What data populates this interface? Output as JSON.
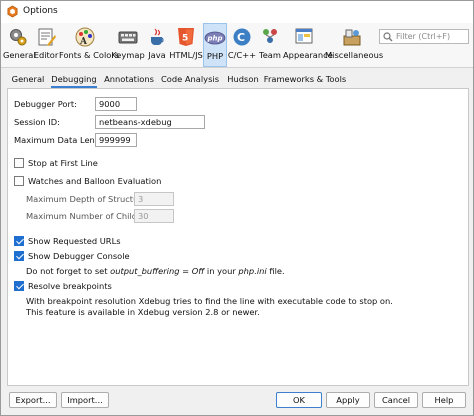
{
  "window": {
    "title": "Options"
  },
  "toolbar": {
    "categories": [
      {
        "label": "General",
        "icon": "gear-icon"
      },
      {
        "label": "Editor",
        "icon": "editor-icon"
      },
      {
        "label": "Fonts & Colors",
        "icon": "fonts-colors-icon"
      },
      {
        "label": "Keymap",
        "icon": "keyboard-icon"
      },
      {
        "label": "Java",
        "icon": "java-cup-icon"
      },
      {
        "label": "HTML/JS",
        "icon": "html5-icon"
      },
      {
        "label": "PHP",
        "icon": "php-icon"
      },
      {
        "label": "C/C++",
        "icon": "cpp-icon"
      },
      {
        "label": "Team",
        "icon": "team-icon"
      },
      {
        "label": "Appearance",
        "icon": "appearance-icon"
      },
      {
        "label": "Miscellaneous",
        "icon": "miscellaneous-icon"
      }
    ],
    "active_category": "PHP",
    "filter_placeholder": "Filter (Ctrl+F)"
  },
  "tabs": [
    {
      "label": "General"
    },
    {
      "label": "Debugging"
    },
    {
      "label": "Annotations"
    },
    {
      "label": "Code Analysis"
    },
    {
      "label": "Hudson"
    },
    {
      "label": "Frameworks & Tools"
    }
  ],
  "active_tab": "Debugging",
  "debugging": {
    "debugger_port": {
      "label": "Debugger Port:",
      "value": "9000"
    },
    "session_id": {
      "label": "Session ID:",
      "value": "netbeans-xdebug"
    },
    "max_data_length": {
      "label": "Maximum Data Length:",
      "value": "999999"
    },
    "stop_at_first_line": {
      "label": "Stop at First Line",
      "checked": false
    },
    "watches_balloon": {
      "label": "Watches and Balloon Evaluation",
      "checked": false
    },
    "max_depth": {
      "label": "Maximum Depth of Structures:",
      "value": "3"
    },
    "max_children": {
      "label": "Maximum Number of Children:",
      "value": "30"
    },
    "show_requested_urls": {
      "label": "Show Requested URLs",
      "checked": true
    },
    "show_debugger_console": {
      "label": "Show Debugger Console",
      "checked": true
    },
    "console_note": {
      "prefix": "Do not forget to set ",
      "setting": "output_buffering = Off",
      "middle": " in your ",
      "file": "php.ini",
      "suffix": " file."
    },
    "resolve_breakpoints": {
      "label": "Resolve breakpoints",
      "checked": true
    },
    "resolve_note_line1": "With breakpoint resolution Xdebug tries to find the line with executable code to stop on.",
    "resolve_note_line2": "This feature is available in Xdebug version 2.8 or newer."
  },
  "buttons": {
    "export": "Export...",
    "import": "Import...",
    "ok": "OK",
    "apply": "Apply",
    "cancel": "Cancel",
    "help": "Help"
  }
}
